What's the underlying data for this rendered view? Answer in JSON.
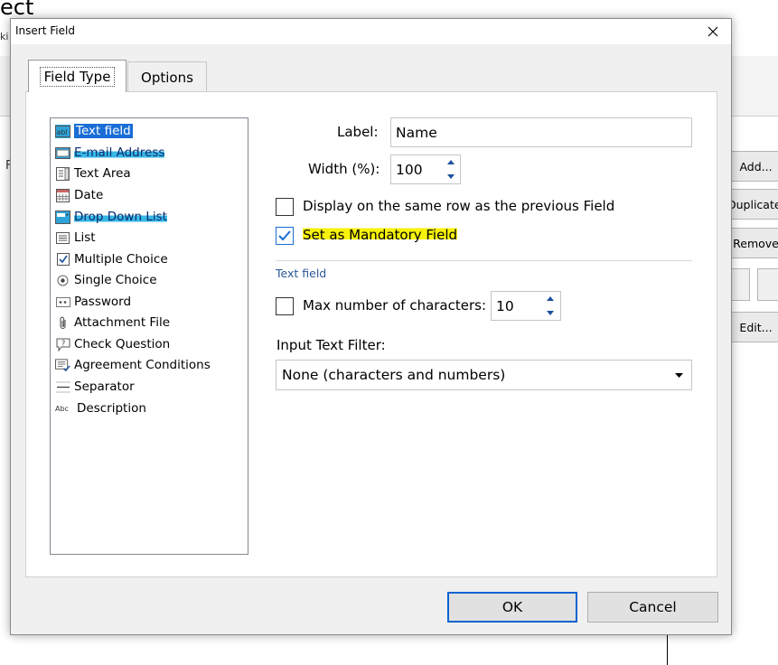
{
  "background": {
    "title": "ect",
    "subtitle": "ki",
    "left_label": "F",
    "buttons": {
      "add": "Add...",
      "duplicate": "Duplicate",
      "remove": "Remove",
      "edit": "Edit..."
    }
  },
  "dialog": {
    "title": "Insert Field",
    "tabs": [
      {
        "label": "Field Type",
        "active": true
      },
      {
        "label": "Options",
        "active": false
      }
    ],
    "field_types": [
      {
        "label": "Text field",
        "icon": "text-field-icon",
        "highlight": "selected"
      },
      {
        "label": "E-mail Address",
        "icon": "email-icon",
        "highlight": "marker-blue"
      },
      {
        "label": "Text Area",
        "icon": "text-area-icon",
        "highlight": "none"
      },
      {
        "label": "Date",
        "icon": "calendar-icon",
        "highlight": "none"
      },
      {
        "label": "Drop Down List",
        "icon": "dropdown-list-icon",
        "highlight": "marker-blue"
      },
      {
        "label": "List",
        "icon": "list-icon",
        "highlight": "none"
      },
      {
        "label": "Multiple Choice",
        "icon": "checkbox-icon",
        "highlight": "none"
      },
      {
        "label": "Single Choice",
        "icon": "radio-icon",
        "highlight": "none"
      },
      {
        "label": "Password",
        "icon": "password-icon",
        "highlight": "none"
      },
      {
        "label": "Attachment File",
        "icon": "paperclip-icon",
        "highlight": "none"
      },
      {
        "label": "Check Question",
        "icon": "question-icon",
        "highlight": "none"
      },
      {
        "label": "Agreement Conditions",
        "icon": "agreement-icon",
        "highlight": "none"
      },
      {
        "label": "Separator",
        "icon": "separator-icon",
        "highlight": "none"
      },
      {
        "label": "Description",
        "icon": "description-icon",
        "highlight": "none"
      }
    ],
    "form": {
      "label_caption": "Label:",
      "label_value": "Name",
      "width_caption": "Width (%):",
      "width_value": "100",
      "same_row_label": "Display on the same row as the previous Field",
      "same_row_checked": false,
      "mandatory_label": "Set as Mandatory Field",
      "mandatory_checked": true,
      "group_title": "Text field",
      "max_chars_label": "Max number of characters:",
      "max_chars_checked": false,
      "max_chars_value": "10",
      "filter_caption": "Input Text Filter:",
      "filter_value": "None (characters and numbers)"
    },
    "buttons": {
      "ok": "OK",
      "cancel": "Cancel"
    }
  },
  "colors": {
    "marker_blue": "#2ea3d9",
    "selection_blue": "#1a6dd6",
    "marker_yellow": "#f7f20a",
    "group_title": "#2b5797"
  }
}
